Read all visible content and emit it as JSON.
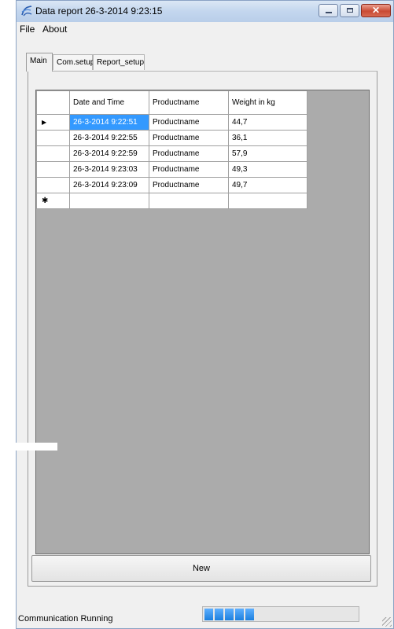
{
  "window": {
    "title": "Data report 26-3-2014 9:23:15"
  },
  "menu": {
    "items": [
      "File",
      "About"
    ]
  },
  "tabs": [
    {
      "label": "Main",
      "active": true
    },
    {
      "label": "Com.setup",
      "active": false
    },
    {
      "label": "Report_setup",
      "active": false
    }
  ],
  "grid": {
    "columns": [
      "Date and Time",
      "Productname",
      "Weight in kg"
    ],
    "rows": [
      {
        "date": "26-3-2014 9:22:51",
        "product": "Productname",
        "weight": "44,7",
        "current": true
      },
      {
        "date": "26-3-2014 9:22:55",
        "product": "Productname",
        "weight": "36,1"
      },
      {
        "date": "26-3-2014 9:22:59",
        "product": "Productname",
        "weight": "57,9"
      },
      {
        "date": "26-3-2014 9:23:03",
        "product": "Productname",
        "weight": "49,3"
      },
      {
        "date": "26-3-2014 9:23:09",
        "product": "Productname",
        "weight": "49,7"
      }
    ],
    "new_row_marker": "✱",
    "current_row_marker": "▶"
  },
  "buttons": {
    "new_label": "New"
  },
  "status": {
    "label": "Communication Running",
    "progress_segments": 5,
    "accent": "#1c7fde"
  }
}
